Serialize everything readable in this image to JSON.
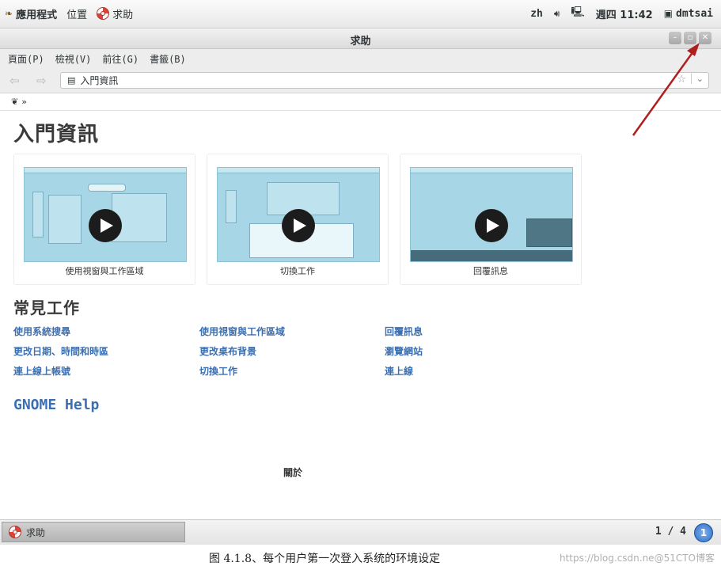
{
  "topbar": {
    "apps_label": "應用程式",
    "places_label": "位置",
    "help_app_label": "求助",
    "lang": "zh",
    "clock": "週四 11:42",
    "user": "dmtsai"
  },
  "window": {
    "title": "求助"
  },
  "menubar": {
    "items": [
      "頁面(P)",
      "檢視(V)",
      "前往(G)",
      "書籤(B)"
    ]
  },
  "location": {
    "text": "入門資訊"
  },
  "page": {
    "title": "入門資訊",
    "videos": [
      {
        "caption": "使用視窗與工作區域"
      },
      {
        "caption": "切換工作"
      },
      {
        "caption": "回覆訊息"
      }
    ],
    "common_title": "常見工作",
    "tasks": [
      [
        "使用系統搜尋",
        "使用視窗與工作區域",
        "回覆訊息"
      ],
      [
        "更改日期、時間和時區",
        "更改桌布背景",
        "瀏覽網站"
      ],
      [
        "連上線上帳號",
        "切換工作",
        "連上線"
      ]
    ],
    "gnome_help": "GNOME Help",
    "about": "關於"
  },
  "taskbar": {
    "task_label": "求助",
    "pager": "1 / 4",
    "workspace": "1"
  },
  "caption": {
    "text": "图 4.1.8、每个用户第一次登入系统的环境设定",
    "watermark": "https://blog.csdn.ne@51CTO博客"
  },
  "colors": {
    "link": "#3c6fb0",
    "thumb": "#a7d7e6",
    "arrow": "#b01e1e"
  }
}
